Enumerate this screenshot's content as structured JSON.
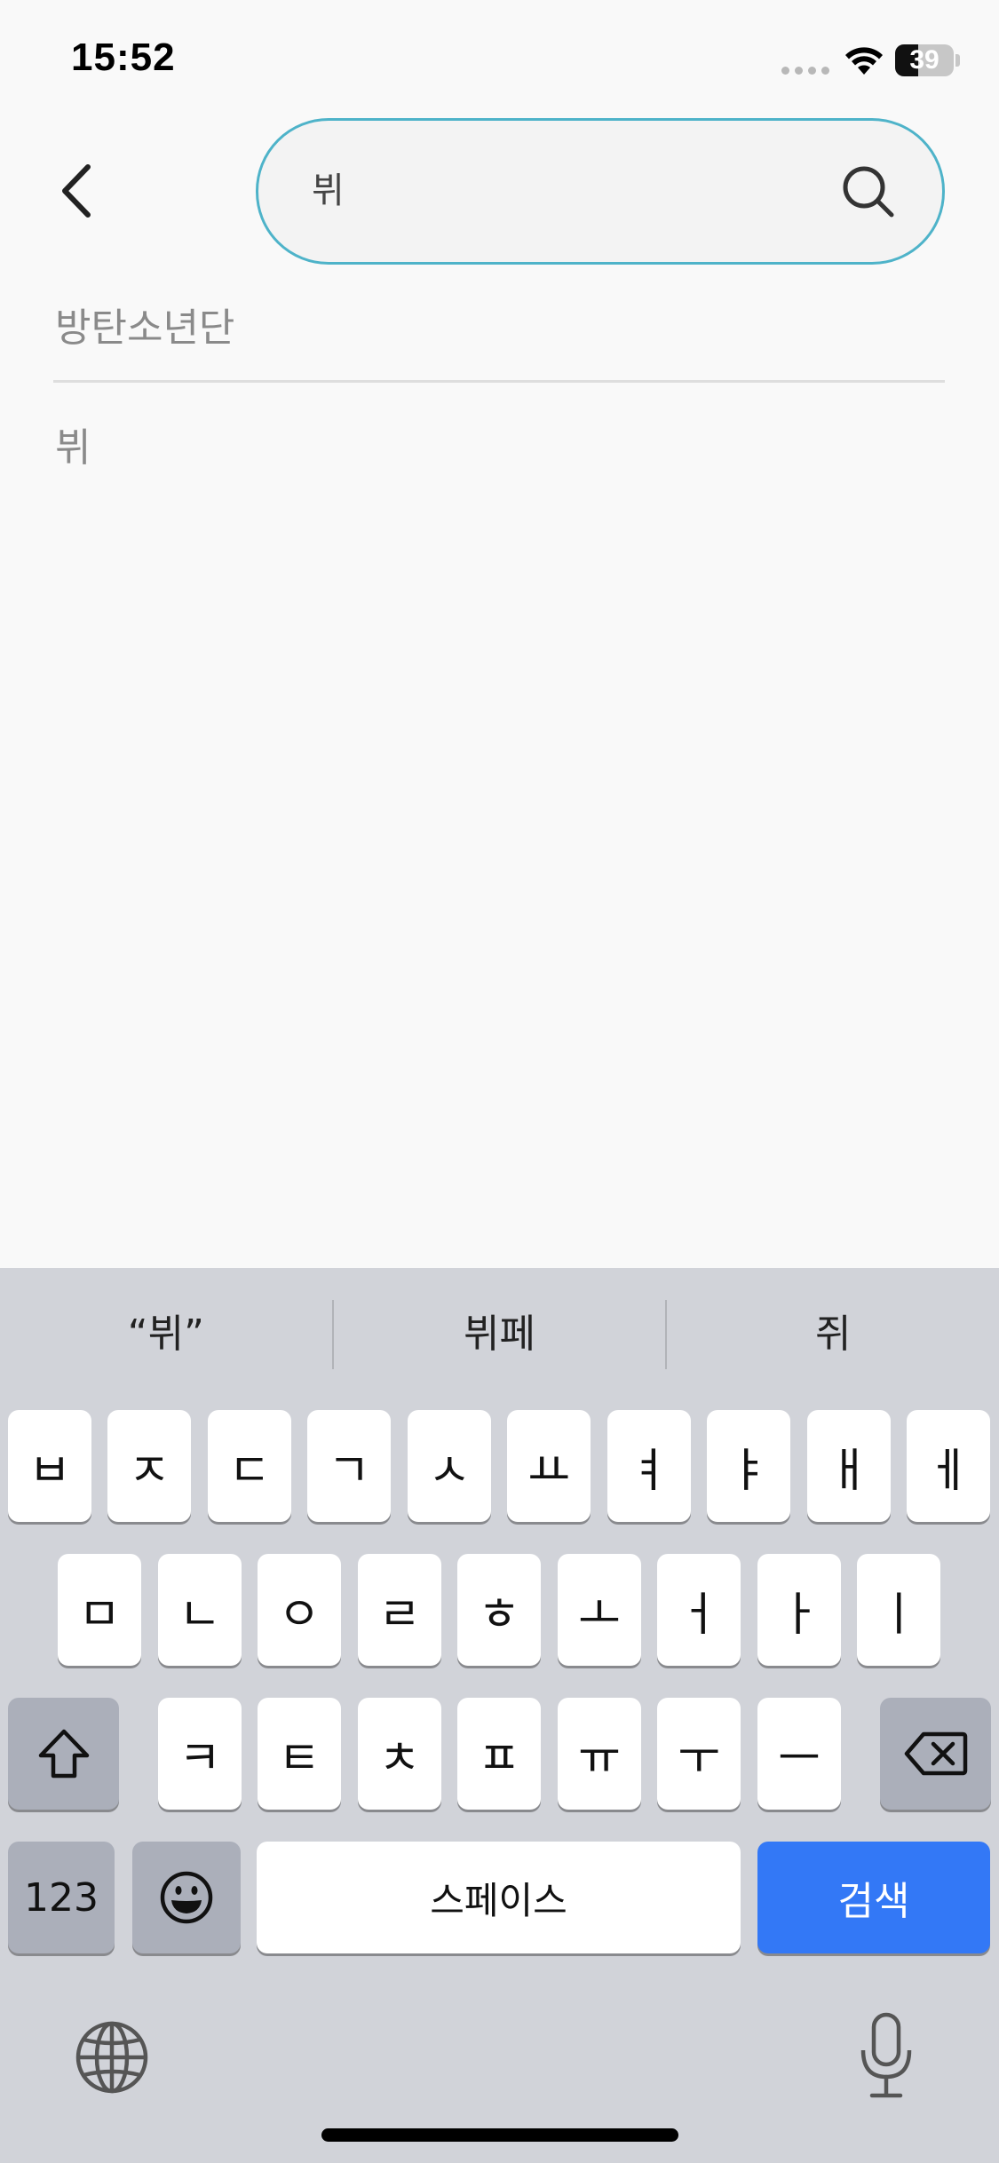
{
  "status_bar": {
    "time": "15:52",
    "battery_level": "39",
    "battery_fraction": 0.39,
    "icons": [
      "cellular-dots-icon",
      "wifi-icon",
      "battery-icon"
    ]
  },
  "header": {
    "back_icon": "chevron-left-icon",
    "search": {
      "value": "뷔",
      "icon": "search-icon",
      "border_color": "#4eb3c9"
    }
  },
  "suggestions": [
    "방탄소년단",
    "뷔"
  ],
  "keyboard": {
    "predictions": [
      "“뷔”",
      "뷔페",
      "쥐"
    ],
    "rows": [
      [
        "ㅂ",
        "ㅈ",
        "ㄷ",
        "ㄱ",
        "ㅅ",
        "ㅛ",
        "ㅕ",
        "ㅑ",
        "ㅐ",
        "ㅔ"
      ],
      [
        "ㅁ",
        "ㄴ",
        "ㅇ",
        "ㄹ",
        "ㅎ",
        "ㅗ",
        "ㅓ",
        "ㅏ",
        "ㅣ"
      ],
      [
        "ㅋ",
        "ㅌ",
        "ㅊ",
        "ㅍ",
        "ㅠ",
        "ㅜ",
        "ㅡ"
      ]
    ],
    "shift_icon": "shift-icon",
    "delete_icon": "backspace-icon",
    "numbers_label": "123",
    "emoji_icon": "emoji-icon",
    "space_label": "스페이스",
    "return_label": "검색",
    "return_color": "#3378f6",
    "globe_icon": "globe-icon",
    "mic_icon": "microphone-icon"
  }
}
